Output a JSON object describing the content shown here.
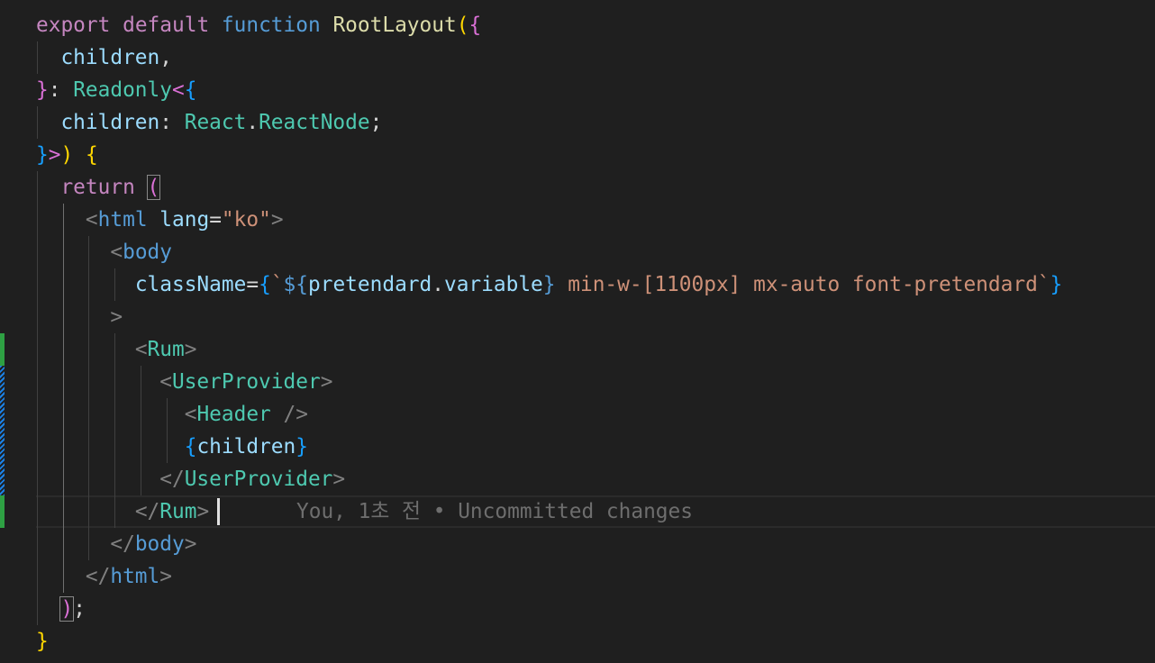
{
  "editor": {
    "lines": [
      [
        "export",
        " ",
        "default",
        " ",
        "function",
        " ",
        "RootLayout",
        "(",
        "{"
      ],
      [
        "  ",
        "children",
        ","
      ],
      [
        "}",
        ": ",
        "Readonly",
        "<",
        "{"
      ],
      [
        "  ",
        "children",
        ": ",
        "React",
        ".",
        "ReactNode",
        ";"
      ],
      [
        "}",
        ">",
        ")",
        " ",
        "{"
      ],
      [
        "  ",
        "return",
        " ",
        "("
      ],
      [
        "    ",
        "<",
        "html",
        " ",
        "lang",
        "=",
        "\"ko\"",
        ">"
      ],
      [
        "      ",
        "<",
        "body"
      ],
      [
        "        ",
        "className",
        "=",
        "{",
        "`",
        "${",
        "pretendard",
        ".",
        "variable",
        "}",
        " min-w-[1100px] mx-auto font-pretendard",
        "`",
        "}"
      ],
      [
        "      ",
        ">"
      ],
      [
        "        ",
        "<",
        "Rum",
        ">"
      ],
      [
        "          ",
        "<",
        "UserProvider",
        ">"
      ],
      [
        "            ",
        "<",
        "Header",
        " ",
        "/>"
      ],
      [
        "            ",
        "{",
        "children",
        "}"
      ],
      [
        "          ",
        "</",
        "UserProvider",
        ">"
      ],
      [
        "        ",
        "</",
        "Rum",
        ">"
      ],
      [
        "      ",
        "</",
        "body",
        ">"
      ],
      [
        "    ",
        "</",
        "html",
        ">"
      ],
      [
        "  ",
        ")",
        ";"
      ],
      [
        "}"
      ]
    ],
    "blame": "You, 1초 전 • Uncommitted changes"
  },
  "colors": {
    "background": "#1f1f1f",
    "added_gutter": "#2ea043",
    "modified_gutter": "#1b81e5"
  }
}
